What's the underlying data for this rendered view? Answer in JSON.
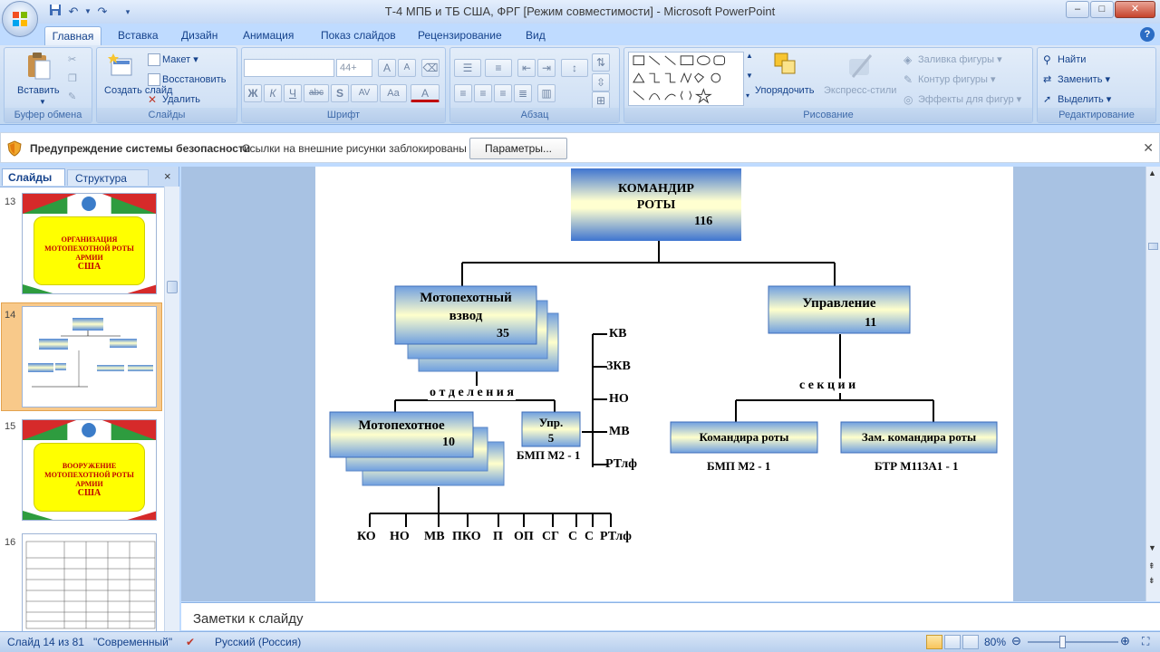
{
  "window": {
    "title": "Т-4 МПБ и ТБ США, ФРГ [Режим совместимости] - Microsoft PowerPoint",
    "controls": {
      "minimize": "–",
      "maximize": "□",
      "close": "✕"
    }
  },
  "tabs": [
    "Главная",
    "Вставка",
    "Дизайн",
    "Анимация",
    "Показ слайдов",
    "Рецензирование",
    "Вид"
  ],
  "ribbon": {
    "clipboard": {
      "label": "Буфер обмена",
      "paste": "Вставить"
    },
    "slides": {
      "label": "Слайды",
      "new_slide": "Создать слайд",
      "layout": "Макет",
      "reset": "Восстановить",
      "delete": "Удалить"
    },
    "font": {
      "label": "Шрифт",
      "font_size": "44+",
      "bold": "Ж",
      "italic": "К",
      "underline": "Ч",
      "strike": "abc",
      "shadow": "S",
      "spacing": "AV",
      "case": "Aa",
      "color": "A"
    },
    "paragraph": {
      "label": "Абзац"
    },
    "drawing": {
      "label": "Рисование",
      "arrange": "Упорядочить",
      "quick_styles": "Экспресс-стили",
      "fill": "Заливка фигуры",
      "outline": "Контур фигуры",
      "effects": "Эффекты для фигур"
    },
    "editing": {
      "label": "Редактирование",
      "find": "Найти",
      "replace": "Заменить",
      "select": "Выделить"
    }
  },
  "security": {
    "title": "Предупреждение системы безопасности",
    "message": "Ссылки на внешние рисунки заблокированы",
    "button": "Параметры..."
  },
  "panel": {
    "tab_slides": "Слайды",
    "tab_outline": "Структура",
    "close": "×",
    "thumbnails": [
      {
        "number": "13",
        "lines": [
          "ОРГАНИЗАЦИЯ",
          "МОТОПЕХОТНОЙ РОТЫ",
          "АРМИИ",
          "США"
        ]
      },
      {
        "number": "14",
        "lines": []
      },
      {
        "number": "15",
        "lines": [
          "ВООРУЖЕНИЕ",
          "МОТОПЕХОТНОЙ РОТЫ",
          "АРМИИ",
          "США"
        ]
      },
      {
        "number": "16",
        "lines": []
      }
    ]
  },
  "slide": {
    "commander": {
      "line1": "КОМАНДИР",
      "line2": "РОТЫ",
      "count": "116"
    },
    "platoon": {
      "line1": "Мотопехотный",
      "line2": "взвод",
      "count": "35"
    },
    "management": {
      "line1": "Управление",
      "count": "11"
    },
    "squads_label": "о т д е л е н и я",
    "sections_label": "с е к ц и и",
    "squad": {
      "line1": "Мотопехотное",
      "count": "10"
    },
    "upr": {
      "line1": "Упр.",
      "count": "5",
      "vehicle": "БМП М2 - 1"
    },
    "upr_roles": [
      "КВ",
      "ЗКВ",
      "НО",
      "МВ",
      "РТлф"
    ],
    "company_cmd": {
      "label": "Командира роты",
      "vehicle": "БМП М2 - 1"
    },
    "deputy_cmd": {
      "label": "Зам. командира роты",
      "vehicle": "БТР М113А1 - 1"
    },
    "squad_roles": [
      "КО",
      "НО",
      "МВ",
      "ПКО",
      "П",
      "ОП",
      "СГ",
      "С",
      "С",
      "РТлф"
    ]
  },
  "notes": {
    "placeholder": "Заметки к слайду"
  },
  "status": {
    "slide_info": "Слайд 14 из 81",
    "theme": "\"Современный\"",
    "language": "Русский (Россия)",
    "zoom": "80%"
  },
  "colors": {
    "accent": "#15428b",
    "ribbon": "#c7dbf3",
    "box_gradient_top": "#4f86d6",
    "box_gradient_mid": "#ffffcc"
  }
}
